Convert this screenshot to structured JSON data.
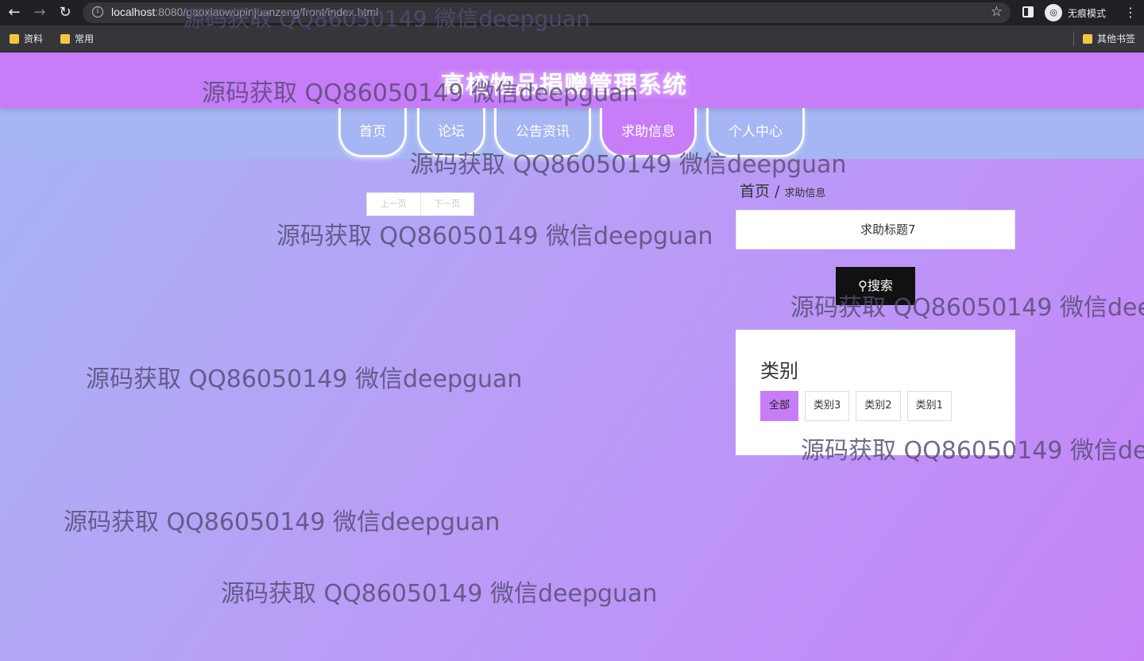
{
  "browser": {
    "url_host": "localhost",
    "url_rest": ":8080/gaoxiaowupinjuanzeng/front/index.html",
    "incognito_label": "无痕模式",
    "bookmarks": [
      {
        "label": "资料"
      },
      {
        "label": "常用"
      }
    ],
    "other_bookmarks": "其他书签"
  },
  "site": {
    "title": "高校物品捐赠管理系统",
    "nav": [
      {
        "label": "首页"
      },
      {
        "label": "论坛"
      },
      {
        "label": "公告资讯"
      },
      {
        "label": "求助信息",
        "active": true
      },
      {
        "label": "个人中心"
      }
    ]
  },
  "pager": {
    "prev": "上一页",
    "next": "下一页"
  },
  "breadcrumb": {
    "home": "首页",
    "separator": "/",
    "current": "求助信息"
  },
  "search": {
    "value": "求助标题7",
    "button_label": "搜索"
  },
  "category": {
    "title": "类别",
    "tags": [
      {
        "label": "全部",
        "active": true
      },
      {
        "label": "类别3"
      },
      {
        "label": "类别2"
      },
      {
        "label": "类别1"
      }
    ]
  },
  "watermark": "源码获取 QQ86050149 微信deepguan",
  "colors": {
    "accent": "#c77cf8",
    "nav_band": "#a6b5f3",
    "search_button": "#111111"
  }
}
